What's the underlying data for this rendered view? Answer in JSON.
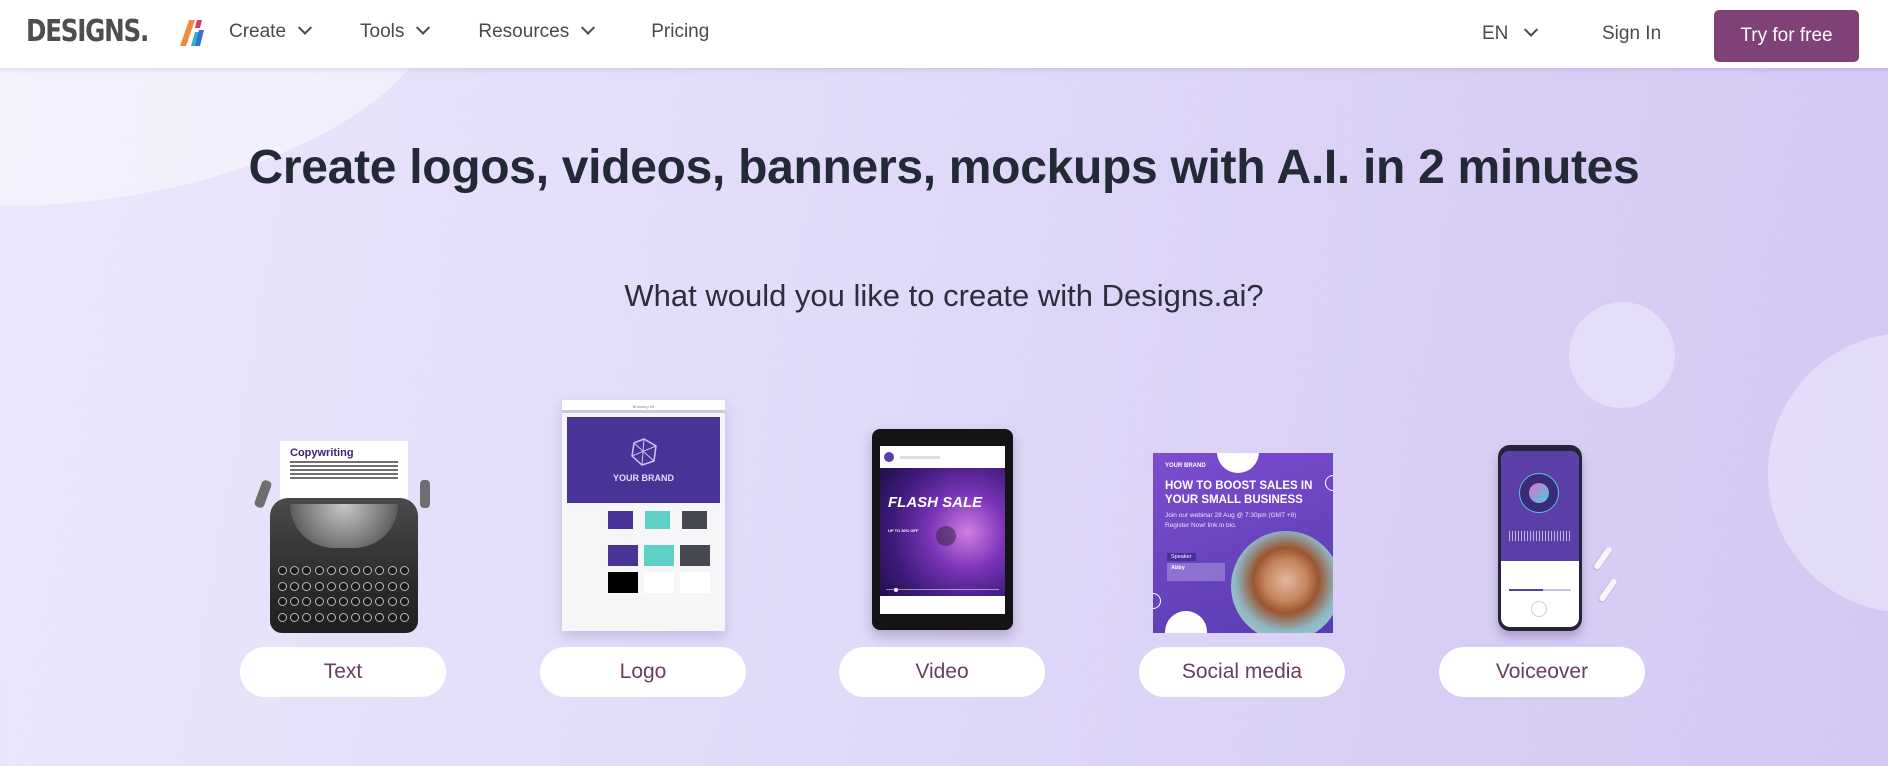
{
  "header": {
    "logo_text": "DESIGNS.",
    "logo_mark": "AI",
    "nav": [
      {
        "label": "Create",
        "has_dropdown": true
      },
      {
        "label": "Tools",
        "has_dropdown": true
      },
      {
        "label": "Resources",
        "has_dropdown": true
      },
      {
        "label": "Pricing",
        "has_dropdown": false
      }
    ],
    "language": "EN",
    "sign_in": "Sign In",
    "cta": "Try for free"
  },
  "hero": {
    "title": "Create logos, videos, banners, mockups with A.I. in 2 minutes",
    "subtitle": "What would you like to create with Designs.ai?"
  },
  "cards": [
    {
      "label": "Text",
      "illustration": "typewriter",
      "paper_title": "Copywriting"
    },
    {
      "label": "Logo",
      "illustration": "branding-kit",
      "kit_header": "Branding Kit",
      "brand_name": "YOUR BRAND"
    },
    {
      "label": "Video",
      "illustration": "tablet-video",
      "headline": "FLASH SALE",
      "subline": "UP TO 30% OFF"
    },
    {
      "label": "Social media",
      "illustration": "social-post",
      "brand": "YOUR BRAND",
      "headline": "HOW TO BOOST SALES IN YOUR SMALL BUSINESS",
      "info_line1": "Join our webinar 28 Aug @ 7:30pm (GMT +8)",
      "info_line2": "Register Now! link in bio.",
      "speaker_tag": "Speaker",
      "speaker_name": "Abby"
    },
    {
      "label": "Voiceover",
      "illustration": "phone-recorder"
    }
  ],
  "colors": {
    "cta_bg": "#804177",
    "heading": "#232a36",
    "card_label": "#6a3d63",
    "brand_purple": "#4a3396",
    "logo_gray": "#4f4d52"
  }
}
